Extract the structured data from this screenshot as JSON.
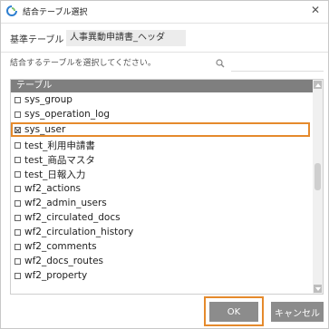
{
  "dialog": {
    "title": "結合テーブル選択",
    "close_glyph": "✕"
  },
  "base": {
    "label": "基準テーブル",
    "value": "人事異動申請書_ヘッダ"
  },
  "search": {
    "placeholder": "結合するテーブルを選択してください。",
    "value": ""
  },
  "list": {
    "column_header": "テーブル",
    "rows": [
      {
        "label": "sys_group",
        "checked": false
      },
      {
        "label": "sys_operation_log",
        "checked": false
      },
      {
        "label": "sys_user",
        "checked": true,
        "selected": true
      },
      {
        "label": "test_利用申請書",
        "checked": false
      },
      {
        "label": "test_商品マスタ",
        "checked": false
      },
      {
        "label": "test_日報入力",
        "checked": false
      },
      {
        "label": "wf2_actions",
        "checked": false
      },
      {
        "label": "wf2_admin_users",
        "checked": false
      },
      {
        "label": "wf2_circulated_docs",
        "checked": false
      },
      {
        "label": "wf2_circulation_history",
        "checked": false
      },
      {
        "label": "wf2_comments",
        "checked": false
      },
      {
        "label": "wf2_docs_routes",
        "checked": false
      },
      {
        "label": "wf2_property",
        "checked": false
      }
    ]
  },
  "buttons": {
    "ok": "OK",
    "cancel": "キャンセル"
  },
  "colors": {
    "highlight": "#e58a2c",
    "button": "#8c8c8c",
    "header": "#7f7f7f"
  }
}
